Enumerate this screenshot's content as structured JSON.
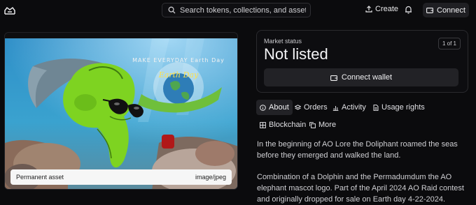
{
  "header": {
    "search_placeholder": "Search tokens, collections, and assets",
    "create_label": "Create",
    "connect_label": "Connect"
  },
  "asset": {
    "permanence_label": "Permanent asset",
    "mime_type": "image/jpeg",
    "artwork_text": "MAKE EVERYDAY Earth Day"
  },
  "market": {
    "status_label": "Market status",
    "status_value": "Not listed",
    "count": "1 of 1",
    "wallet_button": "Connect wallet"
  },
  "tabs": [
    {
      "label": "About",
      "icon": "info-icon",
      "active": true
    },
    {
      "label": "Orders",
      "icon": "layers-icon",
      "active": false
    },
    {
      "label": "Activity",
      "icon": "bar-chart-icon",
      "active": false
    },
    {
      "label": "Usage rights",
      "icon": "document-icon",
      "active": false
    },
    {
      "label": "Blockchain",
      "icon": "grid-icon",
      "active": false
    },
    {
      "label": "More",
      "icon": "copy-icon",
      "active": false
    }
  ],
  "description": {
    "paragraph_1": "In the beginning of AO Lore the Doliphant roamed the seas before they emerged and walked the land.",
    "paragraph_2": "Combination of a Dolphin and the Permadumdum the AO elephant mascot logo. Part of the April 2024 AO Raid contest and originally dropped for sale on Earth day 4-22-2024."
  },
  "colors": {
    "background": "#0b0b0d",
    "accent_green": "#7ed321"
  }
}
